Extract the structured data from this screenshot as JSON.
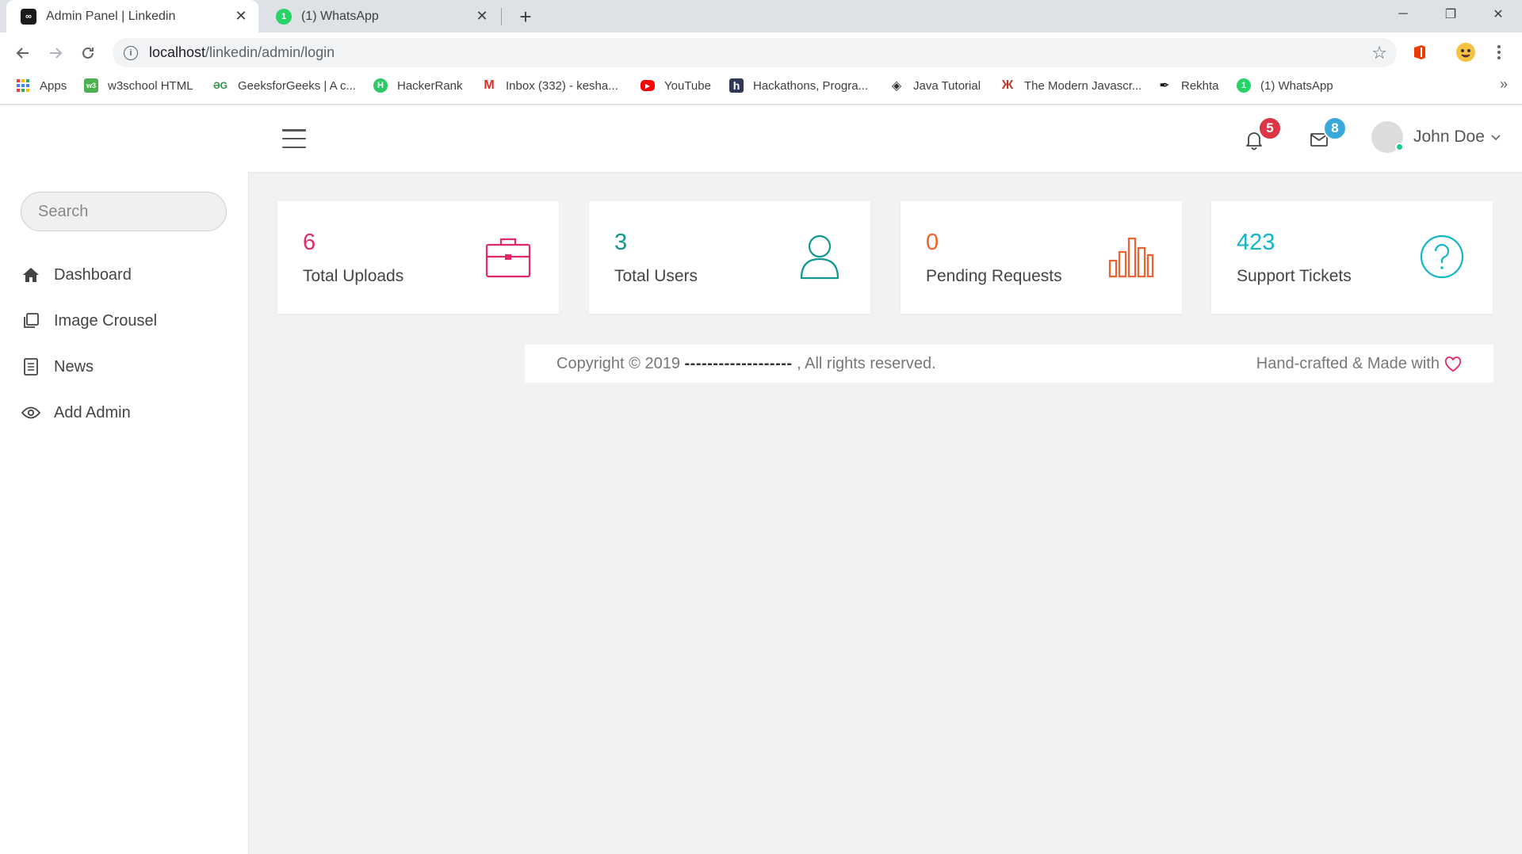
{
  "browser": {
    "tabs": [
      {
        "title": "Admin Panel | Linkedin",
        "active": true,
        "icon": "infinity-icon"
      },
      {
        "title": "(1) WhatsApp",
        "active": false,
        "icon": "whatsapp-icon"
      }
    ],
    "url_host": "localhost",
    "url_path": "/linkedin/admin/login",
    "bookmarks": [
      {
        "label": "Apps",
        "icon": "apps-grid-icon"
      },
      {
        "label": "w3school HTML",
        "icon": "w3schools-icon"
      },
      {
        "label": "GeeksforGeeks | A c...",
        "icon": "geeksforgeeks-icon"
      },
      {
        "label": "HackerRank",
        "icon": "hackerrank-icon"
      },
      {
        "label": "Inbox (332) - kesha...",
        "icon": "gmail-icon"
      },
      {
        "label": "YouTube",
        "icon": "youtube-icon"
      },
      {
        "label": "Hackathons, Progra...",
        "icon": "hackerearth-icon"
      },
      {
        "label": "Java Tutorial",
        "icon": "java-tutorial-icon"
      },
      {
        "label": "The Modern Javascr...",
        "icon": "javascript-info-icon"
      },
      {
        "label": "Rekhta",
        "icon": "rekhta-icon"
      },
      {
        "label": "(1) WhatsApp",
        "icon": "whatsapp-icon"
      }
    ],
    "more_bookmarks": "»"
  },
  "header": {
    "notifications_count": "5",
    "messages_count": "8",
    "user_name": "John Doe",
    "colors": {
      "notif_badge": "#dc3545",
      "msg_badge": "#39a9db"
    }
  },
  "sidebar": {
    "search_placeholder": "Search",
    "items": [
      {
        "label": "Dashboard",
        "icon": "home-icon"
      },
      {
        "label": "Image Crousel",
        "icon": "copy-icon"
      },
      {
        "label": "News",
        "icon": "document-icon"
      },
      {
        "label": "Add Admin",
        "icon": "eye-icon"
      }
    ]
  },
  "cards": [
    {
      "value": "6",
      "label": "Total Uploads",
      "icon": "briefcase-icon",
      "color": "#e3286b"
    },
    {
      "value": "3",
      "label": "Total Users",
      "icon": "user-icon",
      "color": "#10998f"
    },
    {
      "value": "0",
      "label": "Pending Requests",
      "icon": "bar-chart-icon",
      "color": "#f0622d"
    },
    {
      "value": "423",
      "label": "Support Tickets",
      "icon": "question-circle-icon",
      "color": "#12b5c9"
    }
  ],
  "footer": {
    "copyright_prefix": "Copyright © 2019",
    "copyright_dashes": "-------------------",
    "copyright_suffix": ", All rights reserved.",
    "made_with": "Hand-crafted & Made with",
    "heart_color": "#e3286b"
  }
}
